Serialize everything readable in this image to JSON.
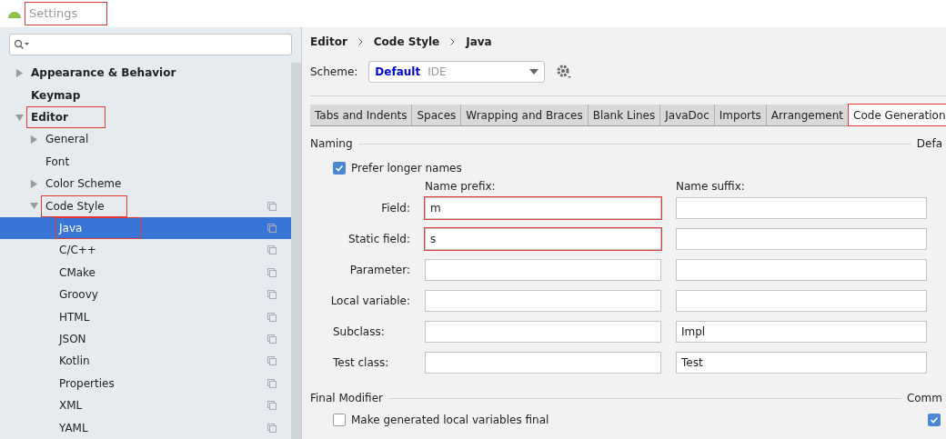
{
  "window": {
    "title": "Settings",
    "annotated": true
  },
  "sidebar": {
    "items": [
      {
        "label": "Appearance & Behavior",
        "expanded": false,
        "selected": false,
        "annotated": false
      },
      {
        "label": "Keymap",
        "selected": false,
        "annotated": false
      },
      {
        "label": "Editor",
        "expanded": true,
        "selected": false,
        "annotated": true,
        "children": [
          {
            "label": "General",
            "expanded": false,
            "selected": false,
            "annotated": false
          },
          {
            "label": "Font",
            "selected": false,
            "annotated": false
          },
          {
            "label": "Color Scheme",
            "expanded": false,
            "selected": false,
            "annotated": false
          },
          {
            "label": "Code Style",
            "expanded": true,
            "copy": true,
            "selected": false,
            "annotated": true,
            "children": [
              {
                "label": "Java",
                "selected": true,
                "annotated": true
              },
              {
                "label": "C/C++",
                "selected": false,
                "annotated": false
              },
              {
                "label": "CMake",
                "selected": false,
                "annotated": false
              },
              {
                "label": "Groovy",
                "selected": false,
                "annotated": false
              },
              {
                "label": "HTML",
                "selected": false,
                "annotated": false
              },
              {
                "label": "JSON",
                "selected": false,
                "annotated": false
              },
              {
                "label": "Kotlin",
                "selected": false,
                "annotated": false
              },
              {
                "label": "Properties",
                "selected": false,
                "annotated": false
              },
              {
                "label": "XML",
                "selected": false,
                "annotated": false
              },
              {
                "label": "YAML",
                "selected": false,
                "annotated": false
              }
            ]
          }
        ]
      }
    ]
  },
  "breadcrumb": [
    "Editor",
    "Code Style",
    "Java"
  ],
  "scheme": {
    "label": "Scheme:",
    "name": "Default",
    "scope": "IDE"
  },
  "tabs": [
    {
      "label": "Tabs and Indents",
      "selected": false,
      "annotated": false
    },
    {
      "label": "Spaces",
      "selected": false,
      "annotated": false
    },
    {
      "label": "Wrapping and Braces",
      "selected": false,
      "annotated": false
    },
    {
      "label": "Blank Lines",
      "selected": false,
      "annotated": false
    },
    {
      "label": "JavaDoc",
      "selected": false,
      "annotated": false
    },
    {
      "label": "Imports",
      "selected": false,
      "annotated": false
    },
    {
      "label": "Arrangement",
      "selected": false,
      "annotated": false
    },
    {
      "label": "Code Generation",
      "selected": true,
      "annotated": true
    }
  ],
  "naming": {
    "title": "Naming",
    "side_title": "Defa",
    "prefer_longer": {
      "label": "Prefer longer names",
      "checked": true
    },
    "prefix_header": "Name prefix:",
    "suffix_header": "Name suffix:",
    "rows": [
      {
        "label": "Field:",
        "prefix": "m",
        "suffix": "",
        "annotated": true
      },
      {
        "label": "Static field:",
        "prefix": "s",
        "suffix": "",
        "annotated": true
      },
      {
        "label": "Parameter:",
        "prefix": "",
        "suffix": "",
        "annotated": false
      },
      {
        "label": "Local variable:",
        "prefix": "",
        "suffix": "",
        "annotated": false
      },
      {
        "label": "Subclass:",
        "prefix": "",
        "suffix": "Impl",
        "annotated": false
      },
      {
        "label": "Test class:",
        "prefix": "",
        "suffix": "Test",
        "annotated": false
      }
    ]
  },
  "final_modifier": {
    "title": "Final Modifier",
    "side_title": "Comm",
    "side_checked": true,
    "option": {
      "label": "Make generated local variables final",
      "checked": false
    }
  }
}
